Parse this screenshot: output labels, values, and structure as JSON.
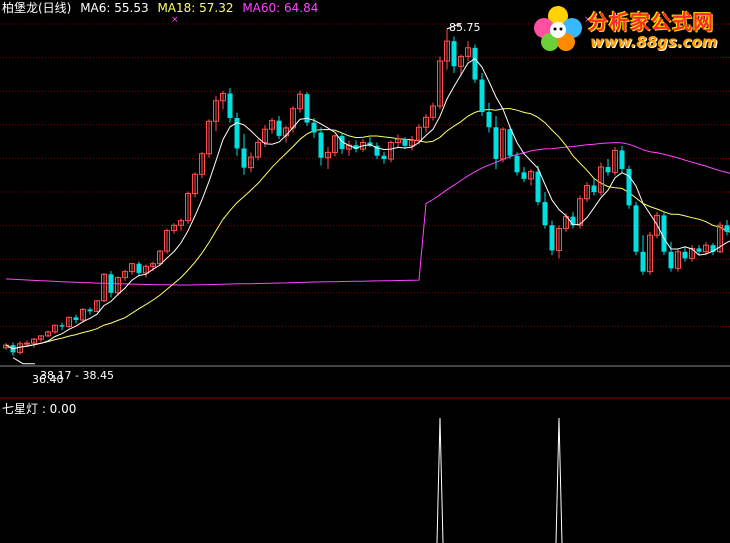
{
  "legend": {
    "title": "柏堡龙(日线)",
    "ma6_label": "MA6: 55.53",
    "ma18_label": "MA18: 57.32",
    "ma60_label": "MA60: 64.84"
  },
  "annotations": {
    "high": "85.75",
    "low": "36.40",
    "range": "38.17 - 38.45"
  },
  "indicator": {
    "label": "七星灯 : 0.00"
  },
  "logo": {
    "title": "分析家公式网",
    "url": "www.88gs.com"
  },
  "colors": {
    "up": "#ff5050",
    "down": "#00e0e0",
    "ma6": "#ffffff",
    "ma18": "#ffff66",
    "ma60": "#ff44ff",
    "grid": "#8a0000",
    "legend_ma6": "#ffffff",
    "legend_ma18": "#ffff66",
    "legend_ma60": "#ff44ff",
    "signal": "#ffffff"
  },
  "chart_data": {
    "type": "candlestick",
    "title": "柏堡龙(日线)",
    "ylim": [
      35,
      88
    ],
    "ohlc": [
      [
        37.6,
        38.3,
        37.3,
        38.0
      ],
      [
        38.0,
        38.4,
        36.4,
        36.9
      ],
      [
        36.9,
        38.6,
        36.6,
        38.2
      ],
      [
        38.2,
        38.7,
        37.7,
        38.3
      ],
      [
        38.3,
        39.1,
        37.6,
        38.9
      ],
      [
        38.9,
        39.5,
        38.5,
        39.4
      ],
      [
        39.4,
        40.2,
        39.2,
        40.0
      ],
      [
        40.0,
        41.1,
        39.7,
        41.0
      ],
      [
        41.0,
        41.4,
        40.3,
        40.8
      ],
      [
        40.8,
        42.3,
        40.6,
        42.2
      ],
      [
        42.2,
        42.6,
        41.3,
        41.8
      ],
      [
        41.8,
        43.6,
        41.4,
        43.4
      ],
      [
        43.4,
        43.7,
        42.6,
        43.1
      ],
      [
        43.1,
        44.8,
        43.0,
        44.7
      ],
      [
        44.7,
        48.9,
        44.5,
        48.7
      ],
      [
        48.7,
        49.2,
        45.2,
        45.9
      ],
      [
        45.9,
        48.4,
        45.5,
        48.2
      ],
      [
        48.2,
        49.4,
        47.7,
        49.1
      ],
      [
        49.1,
        50.4,
        48.6,
        50.3
      ],
      [
        50.3,
        50.6,
        48.4,
        48.9
      ],
      [
        48.9,
        50.2,
        48.2,
        49.9
      ],
      [
        49.9,
        50.6,
        49.2,
        50.3
      ],
      [
        50.3,
        52.4,
        50.0,
        52.2
      ],
      [
        52.2,
        55.6,
        51.8,
        55.3
      ],
      [
        55.3,
        56.4,
        54.8,
        56.1
      ],
      [
        56.1,
        57.1,
        55.3,
        56.8
      ],
      [
        56.8,
        61.2,
        56.3,
        60.9
      ],
      [
        60.9,
        64.1,
        60.3,
        63.8
      ],
      [
        63.8,
        67.2,
        63.2,
        66.9
      ],
      [
        66.9,
        72.1,
        66.3,
        71.8
      ],
      [
        71.8,
        75.6,
        70.3,
        74.9
      ],
      [
        74.9,
        76.4,
        73.6,
        76.0
      ],
      [
        76.0,
        76.8,
        71.6,
        72.3
      ],
      [
        72.3,
        73.1,
        66.6,
        67.7
      ],
      [
        67.7,
        69.9,
        63.7,
        64.8
      ],
      [
        64.8,
        67.1,
        64.1,
        66.4
      ],
      [
        66.4,
        69.1,
        65.9,
        68.6
      ],
      [
        68.6,
        71.2,
        67.9,
        70.6
      ],
      [
        70.6,
        72.3,
        69.9,
        71.9
      ],
      [
        71.9,
        72.6,
        69.1,
        69.6
      ],
      [
        69.6,
        71.1,
        68.6,
        70.8
      ],
      [
        70.8,
        74.1,
        70.1,
        73.7
      ],
      [
        73.7,
        76.4,
        73.1,
        75.9
      ],
      [
        75.9,
        76.2,
        71.1,
        71.6
      ],
      [
        71.6,
        72.3,
        69.3,
        70.1
      ],
      [
        70.1,
        70.9,
        65.1,
        66.3
      ],
      [
        66.3,
        67.9,
        64.6,
        67.1
      ],
      [
        67.1,
        69.8,
        66.5,
        69.6
      ],
      [
        69.6,
        70.1,
        66.9,
        67.6
      ],
      [
        67.6,
        68.9,
        66.6,
        68.2
      ],
      [
        68.2,
        68.9,
        67.1,
        67.6
      ],
      [
        67.6,
        69.1,
        67.2,
        68.6
      ],
      [
        68.6,
        69.4,
        67.9,
        68.1
      ],
      [
        68.1,
        68.6,
        66.1,
        66.6
      ],
      [
        66.6,
        67.2,
        65.4,
        66.1
      ],
      [
        66.1,
        68.9,
        65.6,
        68.6
      ],
      [
        68.6,
        69.8,
        67.9,
        69.1
      ],
      [
        69.1,
        69.4,
        67.6,
        68.1
      ],
      [
        68.1,
        69.6,
        67.4,
        68.9
      ],
      [
        68.9,
        71.4,
        68.3,
        70.9
      ],
      [
        70.9,
        72.9,
        70.1,
        72.4
      ],
      [
        72.4,
        74.6,
        71.9,
        74.1
      ],
      [
        74.1,
        81.6,
        73.6,
        80.9
      ],
      [
        80.9,
        85.75,
        79.6,
        83.9
      ],
      [
        83.9,
        84.6,
        79.1,
        80.1
      ],
      [
        80.1,
        81.9,
        78.6,
        81.6
      ],
      [
        81.6,
        83.9,
        80.9,
        82.9
      ],
      [
        82.9,
        83.4,
        77.6,
        78.1
      ],
      [
        78.1,
        79.1,
        72.6,
        73.2
      ],
      [
        73.2,
        74.6,
        70.1,
        70.9
      ],
      [
        70.9,
        72.6,
        64.6,
        66.1
      ],
      [
        66.1,
        70.9,
        65.6,
        70.6
      ],
      [
        70.6,
        71.1,
        66.1,
        66.6
      ],
      [
        66.6,
        67.1,
        63.6,
        64.1
      ],
      [
        64.1,
        64.9,
        62.6,
        63.1
      ],
      [
        63.1,
        64.6,
        62.1,
        64.2
      ],
      [
        64.2,
        65.1,
        59.1,
        59.6
      ],
      [
        59.6,
        61.1,
        55.6,
        56.1
      ],
      [
        56.1,
        56.8,
        51.6,
        52.3
      ],
      [
        52.3,
        56.1,
        51.1,
        55.6
      ],
      [
        55.6,
        57.9,
        55.1,
        57.4
      ],
      [
        57.4,
        58.1,
        55.6,
        56.1
      ],
      [
        56.1,
        60.6,
        55.6,
        60.1
      ],
      [
        60.1,
        62.6,
        59.6,
        62.1
      ],
      [
        62.1,
        63.1,
        60.6,
        61.1
      ],
      [
        61.1,
        65.6,
        60.6,
        64.9
      ],
      [
        64.9,
        66.1,
        63.6,
        64.1
      ],
      [
        64.1,
        67.9,
        63.6,
        67.4
      ],
      [
        67.4,
        68.1,
        64.1,
        64.6
      ],
      [
        64.6,
        65.1,
        58.6,
        59.1
      ],
      [
        59.1,
        59.6,
        51.6,
        52.1
      ],
      [
        52.1,
        54.6,
        48.6,
        49.1
      ],
      [
        49.1,
        55.1,
        48.6,
        54.6
      ],
      [
        54.6,
        58.1,
        54.1,
        57.6
      ],
      [
        57.6,
        58.1,
        51.6,
        52.1
      ],
      [
        52.1,
        53.6,
        49.1,
        49.6
      ],
      [
        49.6,
        52.6,
        49.1,
        52.1
      ],
      [
        52.1,
        52.9,
        50.6,
        51.1
      ],
      [
        51.1,
        53.1,
        50.6,
        52.6
      ],
      [
        52.6,
        53.1,
        51.6,
        52.1
      ],
      [
        52.1,
        53.6,
        51.6,
        53.1
      ],
      [
        53.1,
        53.4,
        51.6,
        52.1
      ],
      [
        52.1,
        56.6,
        51.9,
        56.1
      ],
      [
        56.1,
        56.9,
        54.6,
        55.1
      ],
      [
        55.1,
        55.6,
        54.1,
        55.53
      ]
    ],
    "ma6": [],
    "ma18": [],
    "ma60": [],
    "markers_x": [
      24,
      83,
      84
    ],
    "signals_x": [
      62,
      79,
      113,
      137
    ],
    "indicator_label": "七星灯 : 0.00"
  }
}
